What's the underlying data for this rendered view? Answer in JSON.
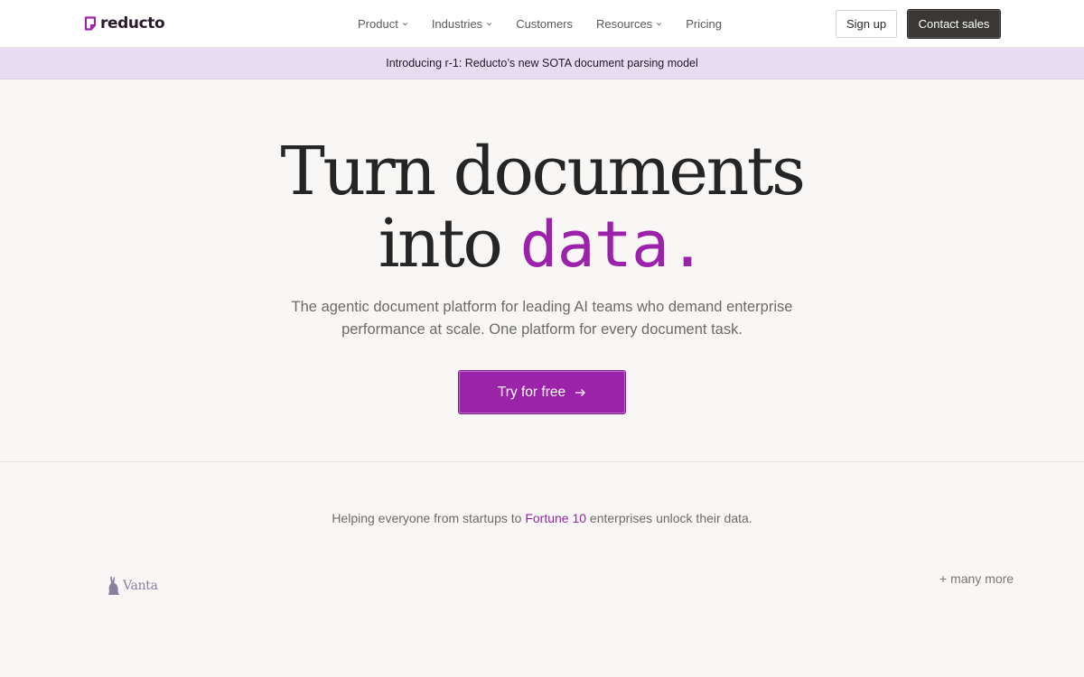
{
  "brand": {
    "name": "reducto",
    "accent": "#9b23a9"
  },
  "nav": {
    "items": [
      {
        "label": "Product",
        "dropdown": true
      },
      {
        "label": "Industries",
        "dropdown": true
      },
      {
        "label": "Customers",
        "dropdown": false
      },
      {
        "label": "Resources",
        "dropdown": true
      },
      {
        "label": "Pricing",
        "dropdown": false
      }
    ],
    "signup_label": "Sign up",
    "contact_label": "Contact sales"
  },
  "banner": {
    "text": "Introducing r‑1: Reducto’s new SOTA document parsing model"
  },
  "hero": {
    "title_line1": "Turn documents",
    "title_line2_prefix": "into ",
    "title_line2_mono": "data.",
    "subtitle": "The agentic document platform for leading AI teams who demand enterprise performance at scale. One platform for every document task.",
    "cta_label": "Try for free",
    "cta_icon": "arrow-right-icon"
  },
  "trust": {
    "prefix": "Helping everyone from startups to ",
    "highlight": "Fortune 10",
    "suffix": " enterprises unlock their data.",
    "logos": [
      {
        "name": "Vanta"
      }
    ],
    "more_label": "+ many more"
  }
}
